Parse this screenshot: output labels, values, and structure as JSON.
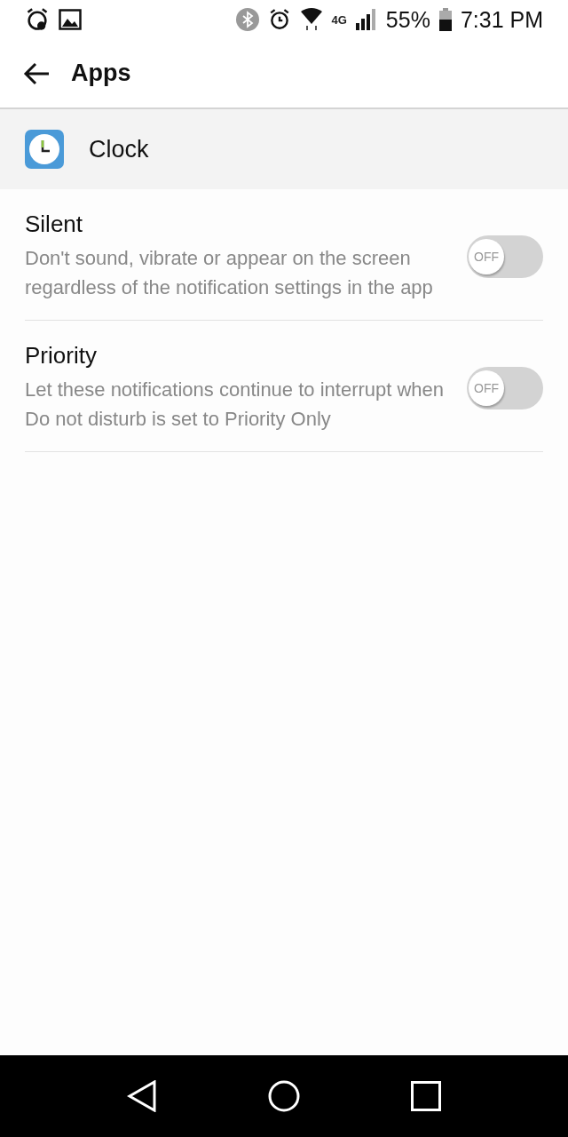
{
  "status_bar": {
    "network": "4G",
    "battery": "55%",
    "time": "7:31 PM"
  },
  "app_bar": {
    "title": "Apps"
  },
  "app_header": {
    "name": "Clock"
  },
  "settings": [
    {
      "title": "Silent",
      "description": "Don't sound, vibrate or appear on the screen regardless of the notification settings in the app",
      "on": false,
      "switch_label": "OFF"
    },
    {
      "title": "Priority",
      "description": "Let these notifications continue to interrupt when Do not disturb is set to Priority Only",
      "on": false,
      "switch_label": "OFF"
    }
  ]
}
